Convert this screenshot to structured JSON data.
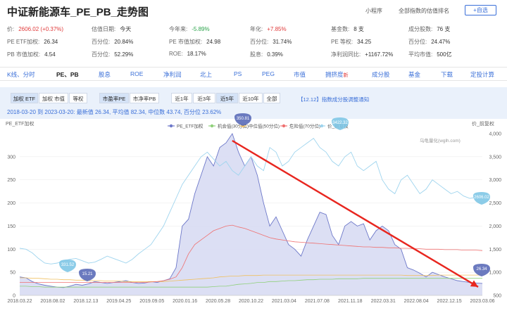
{
  "header": {
    "title": "中证新能源车_PE_PB_走势图",
    "links": [
      "小程序",
      "全部指数的估值排名"
    ],
    "fav_label": "+自选"
  },
  "stats": {
    "row1": [
      {
        "label": "价:",
        "value": "2606.02 (+0.37%)",
        "tone": "red"
      },
      {
        "label": "估值日期:",
        "value": "今天",
        "tone": ""
      },
      {
        "label": "今年来:",
        "value": "-5.89%",
        "tone": "green"
      },
      {
        "label": "年化:",
        "value": "+7.85%",
        "tone": "red"
      },
      {
        "label": "基金数:",
        "value": "8 支",
        "tone": ""
      },
      {
        "label": "成分股数:",
        "value": "76 支",
        "tone": ""
      }
    ],
    "row2": [
      {
        "label": "PE ETF加权:",
        "value": "26.34",
        "tone": ""
      },
      {
        "label": "百分位:",
        "value": "20.84%",
        "tone": ""
      },
      {
        "label": "PE 市值加权:",
        "value": "24.98",
        "tone": ""
      },
      {
        "label": "百分位:",
        "value": "31.74%",
        "tone": ""
      },
      {
        "label": "PE 等权:",
        "value": "34.25",
        "tone": ""
      },
      {
        "label": "百分位:",
        "value": "24.47%",
        "tone": ""
      }
    ],
    "row3": [
      {
        "label": "PB 市值加权:",
        "value": "4.54",
        "tone": ""
      },
      {
        "label": "百分位:",
        "value": "52.29%",
        "tone": ""
      },
      {
        "label": "ROE:",
        "value": "18.17%",
        "tone": ""
      },
      {
        "label": "股息:",
        "value": "0.39%",
        "tone": ""
      },
      {
        "label": "净利润同比:",
        "value": "+1167.72%",
        "tone": ""
      },
      {
        "label": "平均市值:",
        "value": "500亿",
        "tone": ""
      }
    ]
  },
  "nav": [
    {
      "label": "K线、分时",
      "active": false,
      "badge": ""
    },
    {
      "label": "PE、PB",
      "active": true,
      "badge": ""
    },
    {
      "label": "股息",
      "active": false,
      "badge": ""
    },
    {
      "label": "ROE",
      "active": false,
      "badge": ""
    },
    {
      "label": "净利润",
      "active": false,
      "badge": ""
    },
    {
      "label": "北上",
      "active": false,
      "badge": ""
    },
    {
      "label": "PS",
      "active": false,
      "badge": ""
    },
    {
      "label": "PEG",
      "active": false,
      "badge": ""
    },
    {
      "label": "市值",
      "active": false,
      "badge": ""
    },
    {
      "label": "拥挤度",
      "active": false,
      "badge": "新"
    },
    {
      "label": "成分股",
      "active": false,
      "badge": ""
    },
    {
      "label": "基金",
      "active": false,
      "badge": ""
    },
    {
      "label": "下载",
      "active": false,
      "badge": ""
    },
    {
      "label": "定投计算",
      "active": false,
      "badge": ""
    }
  ],
  "controls": {
    "weight": [
      {
        "label": "加权 ETF",
        "sel": true
      },
      {
        "label": "加权 市值",
        "sel": false
      },
      {
        "label": "等权",
        "sel": false
      }
    ],
    "metric": [
      {
        "label": "市盈率PE",
        "sel": true
      },
      {
        "label": "市净率PB",
        "sel": false
      }
    ],
    "range": [
      {
        "label": "近1年",
        "sel": false
      },
      {
        "label": "近3年",
        "sel": false
      },
      {
        "label": "近5年",
        "sel": true
      },
      {
        "label": "近10年",
        "sel": false
      },
      {
        "label": "全部",
        "sel": false
      }
    ],
    "notice": "【12.12】指数成分股调整通知",
    "summary": {
      "period": "2018-03-20 到 2023-03-20:",
      "latest_label": "最新值",
      "latest": "26.34",
      "avg_label": "平均值",
      "avg": "82.34",
      "median_label": "中位数",
      "median": "43.74",
      "pct_label": "百分位",
      "pct": "23.62%"
    }
  },
  "chart_data": {
    "type": "line",
    "left_axis_label": "PE_ETF加权",
    "right_axis_label": "价_前复权",
    "watermark": "乌龟量化(wglh.com)",
    "legend": [
      {
        "name": "PE_ETF加权",
        "color": "#6d78c9"
      },
      {
        "name": "机会值(30分位)",
        "color": "#8fd07a"
      },
      {
        "name": "中位值(50分位)",
        "color": "#f0c060"
      },
      {
        "name": "危险值(70分位)",
        "color": "#ef7070"
      },
      {
        "name": "价_前复权",
        "color": "#9ed4ee"
      }
    ],
    "y_left": {
      "min": 0,
      "max": 350,
      "ticks": [
        0,
        50,
        100,
        150,
        200,
        250,
        300
      ]
    },
    "y_right": {
      "min": 500,
      "max": 4000,
      "ticks": [
        500,
        1000,
        1500,
        2000,
        2500,
        3000,
        3500,
        4000
      ]
    },
    "x_labels": [
      "2018.03.22",
      "2018.08.02",
      "2018.12.13",
      "2019.04.25",
      "2019.09.05",
      "2020.01.16",
      "2020.05.28",
      "2020.10.22",
      "2021.03.04",
      "2021.07.08",
      "2021.11.18",
      "2022.03.31",
      "2022.08.04",
      "2022.12.15",
      "2023.03.06"
    ],
    "pe": [
      40,
      38,
      30,
      25,
      22,
      20,
      18,
      17,
      20,
      24,
      22,
      25,
      30,
      28,
      26,
      28,
      30,
      32,
      28,
      26,
      27,
      30,
      28,
      32,
      36,
      60,
      150,
      165,
      220,
      260,
      300,
      280,
      320,
      330,
      350,
      310,
      280,
      300,
      260,
      200,
      150,
      170,
      140,
      110,
      100,
      85,
      120,
      150,
      180,
      175,
      130,
      110,
      150,
      160,
      150,
      155,
      120,
      140,
      150,
      140,
      110,
      100,
      60,
      55,
      48,
      40,
      50,
      45,
      40,
      36,
      32,
      30,
      28,
      27,
      26
    ],
    "opportunity": [
      20,
      20,
      19,
      19,
      18,
      18,
      18,
      18,
      18,
      18,
      18,
      18,
      18,
      18,
      18,
      18,
      18,
      18,
      18,
      18,
      18,
      18,
      18,
      18,
      18,
      18,
      18,
      18,
      18,
      18,
      18,
      19,
      20,
      20,
      22,
      24,
      25,
      26,
      28,
      28,
      30,
      30,
      31,
      32,
      32,
      33,
      34,
      34,
      35,
      35,
      35,
      36,
      36,
      36,
      36,
      37,
      37,
      37,
      37,
      37,
      37,
      37,
      37,
      37,
      37,
      37,
      37,
      37,
      37,
      37,
      37,
      37,
      37,
      37,
      37
    ],
    "median": [
      38,
      38,
      37,
      37,
      36,
      35,
      35,
      34,
      34,
      33,
      33,
      32,
      32,
      32,
      31,
      31,
      31,
      30,
      30,
      30,
      30,
      30,
      30,
      30,
      31,
      32,
      33,
      34,
      35,
      36,
      37,
      38,
      40,
      41,
      42,
      42,
      43,
      43,
      43,
      44,
      44,
      44,
      44,
      44,
      44,
      44,
      44,
      44,
      44,
      44,
      44,
      44,
      44,
      44,
      44,
      44,
      44,
      44,
      44,
      44,
      44,
      44,
      43,
      43,
      43,
      43,
      43,
      44,
      44,
      44,
      44,
      44,
      44,
      44,
      44
    ],
    "danger": [
      28,
      28,
      28,
      28,
      28,
      28,
      28,
      28,
      28,
      28,
      28,
      28,
      28,
      28,
      28,
      28,
      28,
      28,
      28,
      28,
      28,
      29,
      30,
      32,
      35,
      40,
      60,
      90,
      110,
      120,
      130,
      140,
      145,
      150,
      152,
      148,
      145,
      140,
      135,
      130,
      125,
      122,
      120,
      118,
      116,
      115,
      114,
      113,
      112,
      111,
      110,
      109,
      108,
      107,
      106,
      105,
      105,
      104,
      104,
      103,
      103,
      102,
      102,
      101,
      101,
      100,
      100,
      100,
      99,
      99,
      99,
      98,
      98,
      98,
      97
    ],
    "price": [
      1520,
      1500,
      1420,
      1300,
      1200,
      1180,
      1200,
      1250,
      1280,
      1300,
      1250,
      1200,
      1220,
      1280,
      1350,
      1300,
      1250,
      1200,
      1280,
      1400,
      1500,
      1600,
      1800,
      2000,
      2300,
      2600,
      2900,
      3100,
      3300,
      3500,
      3600,
      3450,
      3300,
      3400,
      3200,
      3100,
      3300,
      3500,
      3300,
      3200,
      3700,
      3600,
      3300,
      3400,
      3600,
      3700,
      3800,
      3900,
      3700,
      3600,
      3400,
      3300,
      3500,
      3600,
      3300,
      3200,
      3300,
      3400,
      3000,
      2800,
      2700,
      3000,
      3100,
      2900,
      2700,
      2800,
      3000,
      2900,
      2800,
      2700,
      2750,
      2650,
      2600,
      2620,
      2606
    ],
    "markers": [
      {
        "text": "331.52",
        "color": "#7fc6e6"
      },
      {
        "text": "15.21",
        "color": "#5b6bb8"
      },
      {
        "text": "350.81",
        "color": "#5b6bb8"
      },
      {
        "text": "3422.32",
        "color": "#7fc6e6"
      },
      {
        "text": "2606.02",
        "color": "#7fc6e6"
      },
      {
        "text": "26.34",
        "color": "#5b6bb8"
      }
    ]
  }
}
